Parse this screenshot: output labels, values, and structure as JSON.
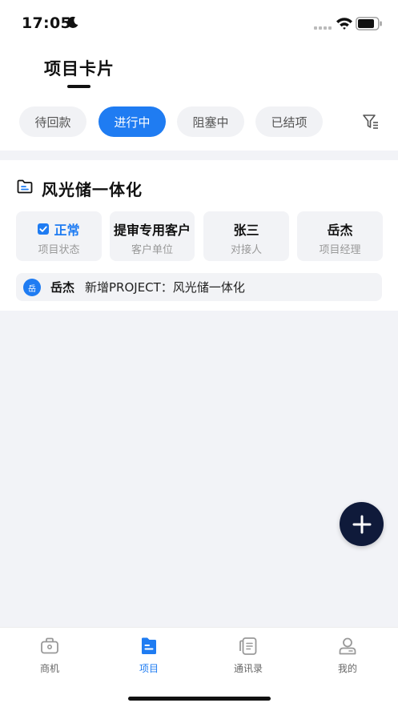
{
  "status_bar": {
    "time": "17:05"
  },
  "header": {
    "title": "项目卡片",
    "tabs": [
      {
        "label": "待回款",
        "active": false
      },
      {
        "label": "进行中",
        "active": true
      },
      {
        "label": "阻塞中",
        "active": false
      },
      {
        "label": "已结项",
        "active": false
      }
    ]
  },
  "project": {
    "name": "风光储一体化",
    "fields": [
      {
        "value": "正常",
        "label": "项目状态"
      },
      {
        "value": "提审专用客户",
        "label": "客户单位"
      },
      {
        "value": "张三",
        "label": "对接人"
      },
      {
        "value": "岳杰",
        "label": "项目经理"
      }
    ],
    "log": {
      "avatar": "岳",
      "user": "岳杰",
      "text": "新增PROJECT：风光储一体化"
    }
  },
  "bottom_nav": [
    {
      "label": "商机",
      "icon": "briefcase-icon",
      "active": false
    },
    {
      "label": "项目",
      "icon": "project-doc-icon",
      "active": true
    },
    {
      "label": "通讯录",
      "icon": "contacts-icon",
      "active": false
    },
    {
      "label": "我的",
      "icon": "profile-icon",
      "active": false
    }
  ],
  "colors": {
    "accent": "#1f7cf2",
    "fab": "#0f1a3a",
    "background": "#f2f3f7"
  }
}
